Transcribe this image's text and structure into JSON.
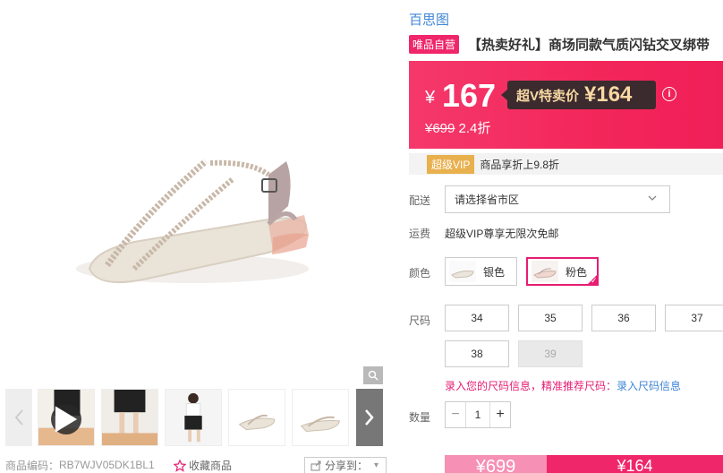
{
  "brand": "百思图",
  "badge": "唯品自营",
  "title": "【热卖好礼】商场同款气质闪钻交叉绑带",
  "price": {
    "yen": "¥",
    "now": "167",
    "svip_label": "超V特卖价",
    "svip_price": "¥164",
    "info": "i",
    "original": "¥699",
    "discount": "2.4折"
  },
  "vip": {
    "badge": "超级VIP",
    "text": "商品享折上9.8折"
  },
  "delivery": {
    "label": "配送",
    "placeholder": "请选择省市区"
  },
  "shipping": {
    "label": "运费",
    "text": "超级VIP尊享无限次免邮"
  },
  "colors": {
    "label": "颜色",
    "options": [
      {
        "name": "银色",
        "selected": false
      },
      {
        "name": "粉色",
        "selected": true
      }
    ]
  },
  "sizes": {
    "label": "尺码",
    "options": [
      "34",
      "35",
      "36",
      "37",
      "38",
      "39"
    ],
    "disabled": [
      "39"
    ]
  },
  "size_help": {
    "text": "录入您的尺码信息，精准推荐尺码：",
    "link": "录入尺码信息"
  },
  "quantity": {
    "label": "数量",
    "minus": "−",
    "value": "1",
    "plus": "+"
  },
  "buy": {
    "original": "¥699",
    "vip": "¥164"
  },
  "footer": {
    "code_label": "商品编码：",
    "code": "RB7WJV05DK1BL1",
    "favorite": "收藏商品",
    "share": "分享到："
  },
  "colors_theme": {
    "accent": "#f0266b",
    "link": "#3e85d6",
    "vip_gold": "#e9b04e"
  }
}
